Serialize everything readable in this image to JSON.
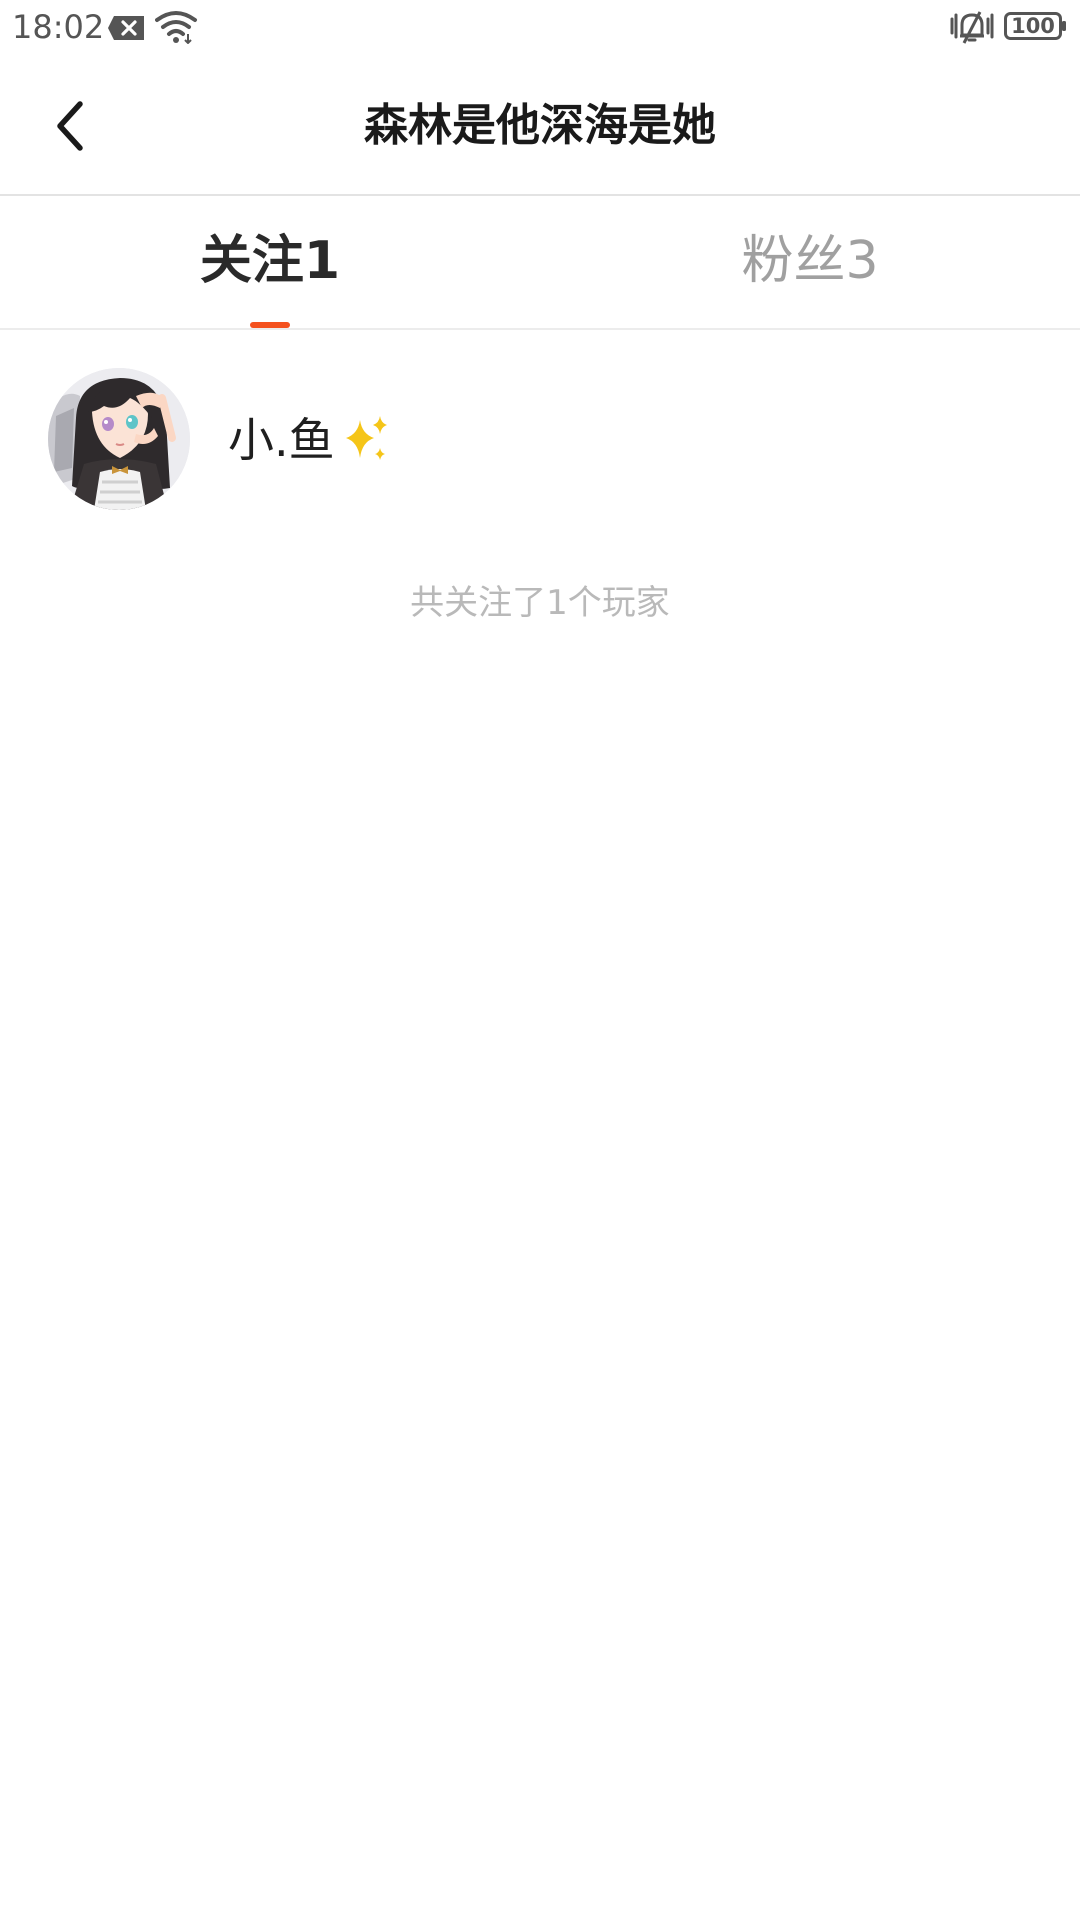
{
  "status_bar": {
    "time": "18:02",
    "battery": "100",
    "icons": [
      "notification-x-icon",
      "wifi-icon",
      "silent-bell-icon",
      "battery-icon"
    ]
  },
  "header": {
    "title": "森林是他深海是她",
    "back_icon": "chevron-left-icon"
  },
  "tabs": [
    {
      "label": "关注1",
      "active": true
    },
    {
      "label": "粉丝3",
      "active": false
    }
  ],
  "colors": {
    "accent": "#f4511e",
    "active_tab_text": "#2a2a2a",
    "inactive_tab_text": "#a0a0a0",
    "summary_text": "#b9b9b9"
  },
  "following_list": [
    {
      "name": "小.鱼",
      "badge_icon": "sparkles-icon",
      "avatar_icon": "anime-girl-avatar"
    }
  ],
  "summary": "共关注了1个玩家"
}
